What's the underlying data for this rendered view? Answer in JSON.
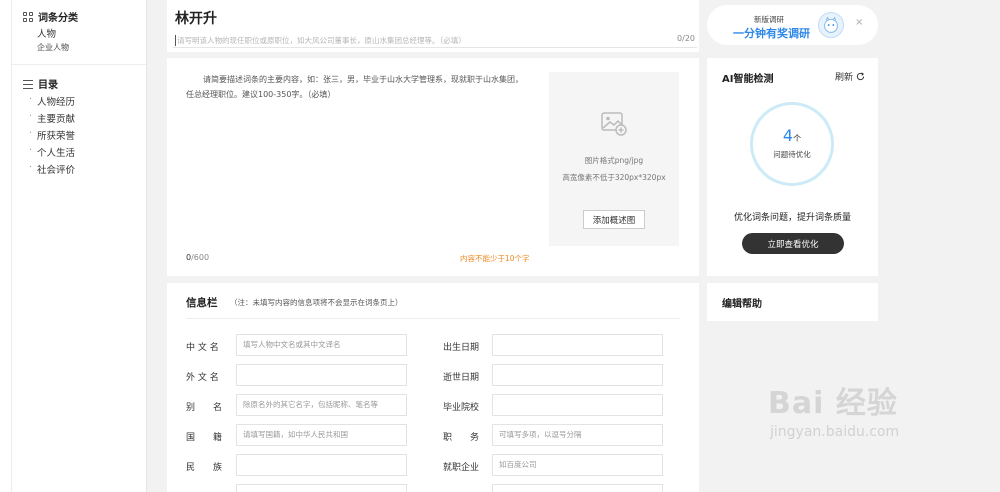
{
  "sidebar": {
    "category_title": "词条分类",
    "categories": [
      "人物",
      "企业人物"
    ],
    "toc_title": "目录",
    "toc_items": [
      "人物经历",
      "主要贡献",
      "所获荣誉",
      "个人生活",
      "社会评价"
    ]
  },
  "entry": {
    "title": "林开升",
    "intro_placeholder": "请写明该人物的现任职位或原职位，如大风公司董事长，原山水集团总经理等。（必填）",
    "intro_count": "0/20"
  },
  "summary": {
    "placeholder": "请简要描述词条的主要内容，如：张三，男，毕业于山水大学管理系，现就职于山水集团，任总经理职位。建议100-350字。（必填）",
    "count_current": "0",
    "count_max": "/600",
    "warning": "内容不能少于10个字",
    "image_format": "图片格式png/jpg",
    "image_size": "高宽像素不低于320px*320px",
    "add_image_button": "添加概述图"
  },
  "info": {
    "title": "信息栏",
    "note": "（注：未填写内容的信息项将不会显示在词条页上）",
    "left_fields": [
      {
        "label": "中 文 名",
        "placeholder": "填写人物中文名或其中文译名"
      },
      {
        "label": "外 文 名",
        "placeholder": ""
      },
      {
        "label": "别　　名",
        "placeholder": "除原名外的其它名字，包括昵称、笔名等"
      },
      {
        "label": "国　　籍",
        "placeholder": "请填写国籍，如中华人民共和国"
      },
      {
        "label": "民　　族",
        "placeholder": ""
      }
    ],
    "right_fields": [
      {
        "label": "出生日期",
        "placeholder": ""
      },
      {
        "label": "逝世日期",
        "placeholder": ""
      },
      {
        "label": "毕业院校",
        "placeholder": ""
      },
      {
        "label": "职　　务",
        "placeholder": "可填写多项，以逗号分隔"
      },
      {
        "label": "就职企业",
        "placeholder": "如百度公司"
      }
    ]
  },
  "survey": {
    "small": "新版调研",
    "main": "一分钟有奖调研",
    "close": "×"
  },
  "ai": {
    "title": "AI智能检测",
    "refresh": "刷新",
    "count": "4",
    "count_unit": "个",
    "count_label": "问题待优化",
    "desc": "优化词条问题，提升词条质量",
    "button": "立即查看优化"
  },
  "help": {
    "title": "编辑帮助"
  },
  "watermark": {
    "logo": "Bai 经验",
    "url": "jingyan.baidu.com"
  },
  "colors": {
    "accent": "#2e88e8",
    "warning": "#f08a24",
    "dark_button": "#333333"
  }
}
